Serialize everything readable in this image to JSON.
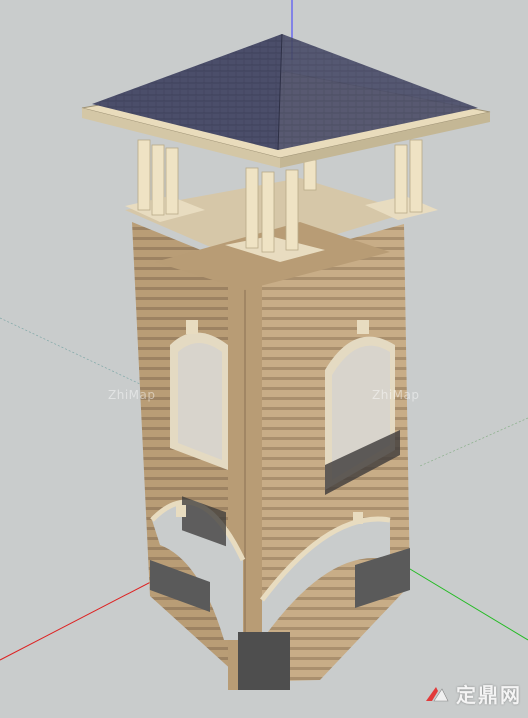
{
  "scene": {
    "subject": "",
    "background_color": "#c9cccc",
    "roof_color": "#4a4d68",
    "wall_color": "#b49a73",
    "trim_color": "#e8dcc0",
    "base_color": "#555555"
  },
  "watermarks": {
    "left": "ZhiMap",
    "right": "ZhiMap"
  },
  "brand": {
    "logo_text": "定鼎网",
    "logo_icon": "zhulong-logo-icon"
  }
}
